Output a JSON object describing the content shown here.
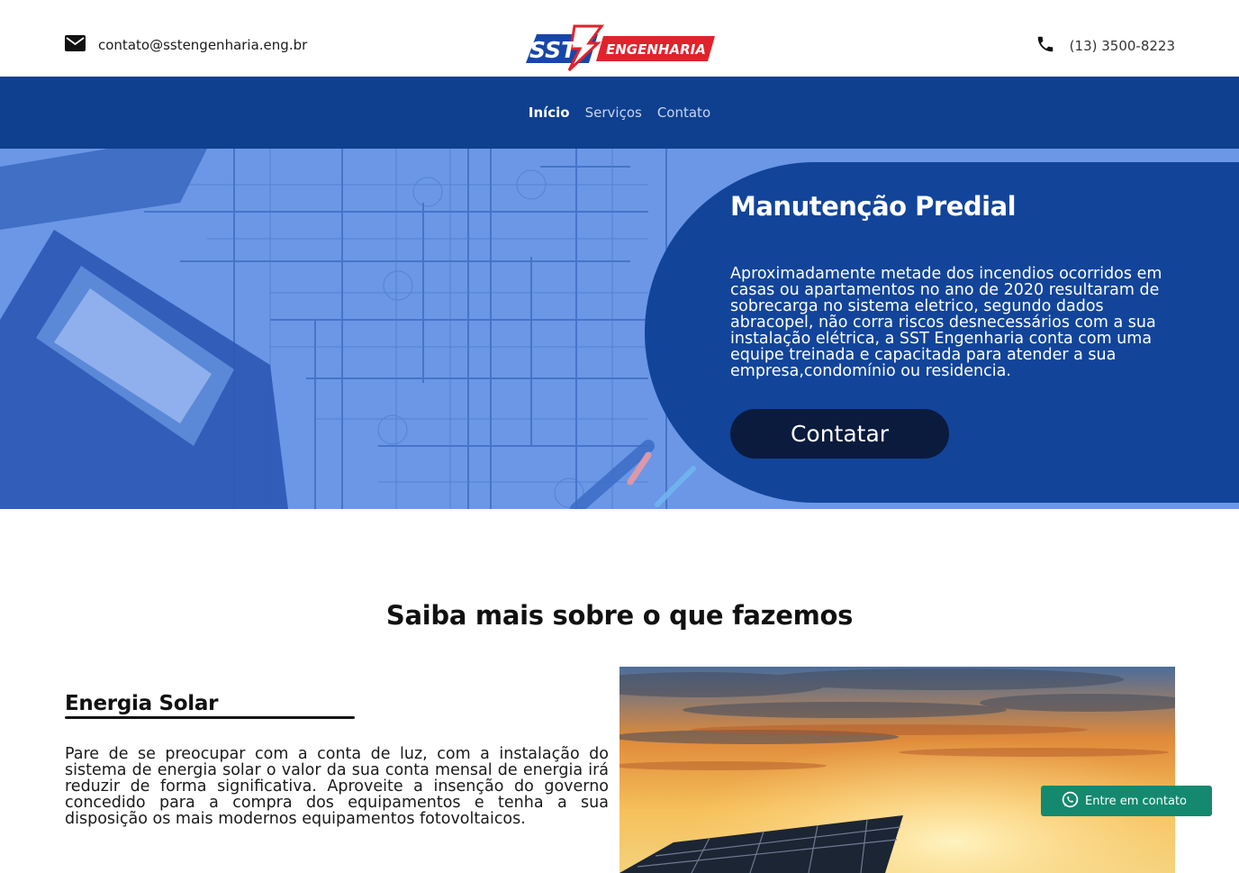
{
  "header": {
    "email": "contato@sstengenharia.eng.br",
    "phone": "(13) 3500-8223",
    "logo": {
      "left_text": "SST",
      "right_text": "ENGENHARIA",
      "colors": {
        "blue": "#1746a8",
        "red": "#e1222b"
      }
    }
  },
  "nav": {
    "items": [
      {
        "label": "Início",
        "active": true
      },
      {
        "label": "Serviços",
        "active": false
      },
      {
        "label": "Contato",
        "active": false
      }
    ]
  },
  "hero": {
    "title": "Manutenção Predial",
    "text": "Aproximadamente metade dos incendios ocorridos em casas ou apartamentos no ano de 2020 resultaram de sobrecarga no sistema eletrico, segundo dados abracopel, não corra riscos desnecessários com a sua instalação elétrica, a SST Engenharia conta com uma equipe treinada e capacitada para atender a sua empresa,condomínio ou residencia.",
    "button_label": "Contatar"
  },
  "section": {
    "title": "Saiba mais sobre o que fazemos",
    "service": {
      "title": "Energia Solar",
      "text": "Pare de se preocupar com a conta de luz, com a instalação do sistema de energia solar o valor da sua conta mensal de energia irá reduzir de forma significativa. Aproveite a insenção do governo concedido para a compra dos equipamentos e tenha a sua disposição os mais modernos equipamentos fotovoltaicos."
    }
  },
  "whatsapp": {
    "label": "Entre em contato"
  },
  "icons": {
    "email": "envelope-icon",
    "phone": "phone-icon",
    "whatsapp": "whatsapp-icon"
  },
  "colors": {
    "nav_bg": "#0f3f8f",
    "hero_panel": "#12449a",
    "hero_button": "#0b1b3d",
    "whatsapp_bg": "#14896f"
  }
}
